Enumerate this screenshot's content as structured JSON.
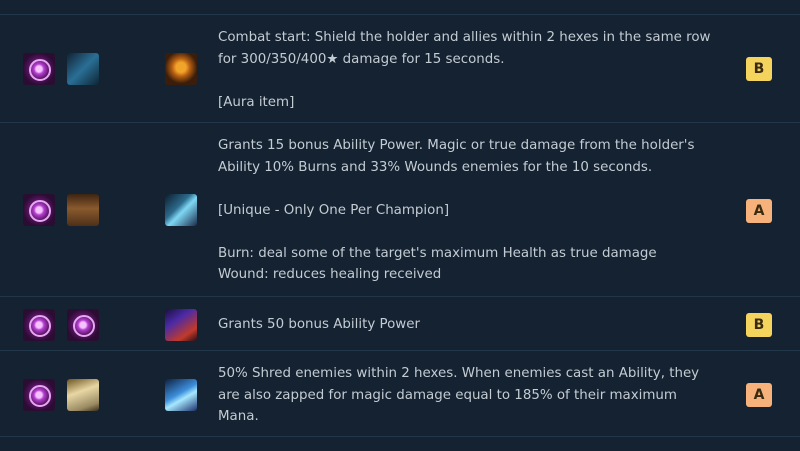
{
  "rows": [
    {
      "components": [
        "spatula-icon",
        "chain-vest-icon"
      ],
      "result_icon": "protectors-vow-icon",
      "description": "Combat start: Shield the holder and allies within 2 hexes in the same row for 300/350/400★ damage for 15 seconds.\n\n[Aura item]",
      "tier": "B"
    },
    {
      "components": [
        "spatula-icon",
        "giants-belt-icon"
      ],
      "result_icon": "sunfire-icon",
      "description": "Grants 15 bonus Ability Power. Magic or true damage from the holder's Ability 10% Burns and 33% Wounds enemies for the 10 seconds.\n\n[Unique - Only One Per Champion]\n\nBurn: deal some of the target's maximum Health as true damage\nWound: reduces healing received",
      "tier": "A"
    },
    {
      "components": [
        "spatula-icon",
        "spatula-icon"
      ],
      "result_icon": "tactician-item-icon",
      "description": "Grants 50 bonus Ability Power",
      "tier": "B"
    },
    {
      "components": [
        "spatula-icon",
        "negatron-cloak-icon"
      ],
      "result_icon": "zephyr-icon",
      "description": "50% Shred enemies within 2 hexes. When enemies cast an Ability, they are also zapped for magic damage equal to 185% of their maximum Mana.",
      "tier": "A"
    }
  ]
}
